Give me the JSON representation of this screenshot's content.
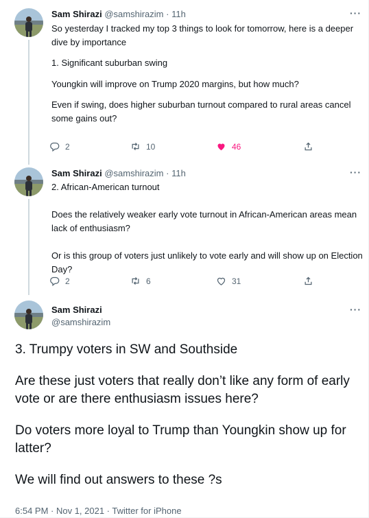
{
  "author": {
    "name": "Sam Shirazi",
    "handle": "@samshirazim"
  },
  "sep": "·",
  "more_label": "···",
  "tweets": [
    {
      "time": "11h",
      "paragraphs": [
        "So yesterday I tracked my top 3 things to look for tomorrow, here is a deeper dive by importance",
        "1. Significant suburban swing",
        "Youngkin will improve on Trump 2020 margins, but how much?",
        "Even if swing, does higher suburban turnout compared to rural areas cancel some gains out?"
      ],
      "replies": "2",
      "retweets": "10",
      "likes": "46",
      "liked": true
    },
    {
      "time": "11h",
      "paragraphs": [
        "2. African-American turnout",
        "Does the relatively weaker early vote turnout in African-American areas mean lack of enthusiasm?",
        "Or is this group of voters just unlikely to vote early and will show up on Election Day?"
      ],
      "replies": "2",
      "retweets": "6",
      "likes": "31",
      "liked": false
    }
  ],
  "main_tweet": {
    "paragraphs": [
      "3. Trumpy voters in SW and Southside",
      "Are these just voters that really don’t like any form of early vote or are there enthusiasm issues here?",
      "Do voters more loyal to Trump than Youngkin show up for latter?",
      "We will find out answers to these ?s"
    ],
    "meta": "6:54 PM · Nov 1, 2021 · Twitter for iPhone"
  },
  "colors": {
    "like_active": "#f91880",
    "muted": "#536471",
    "thread_line": "#cfd9de"
  }
}
